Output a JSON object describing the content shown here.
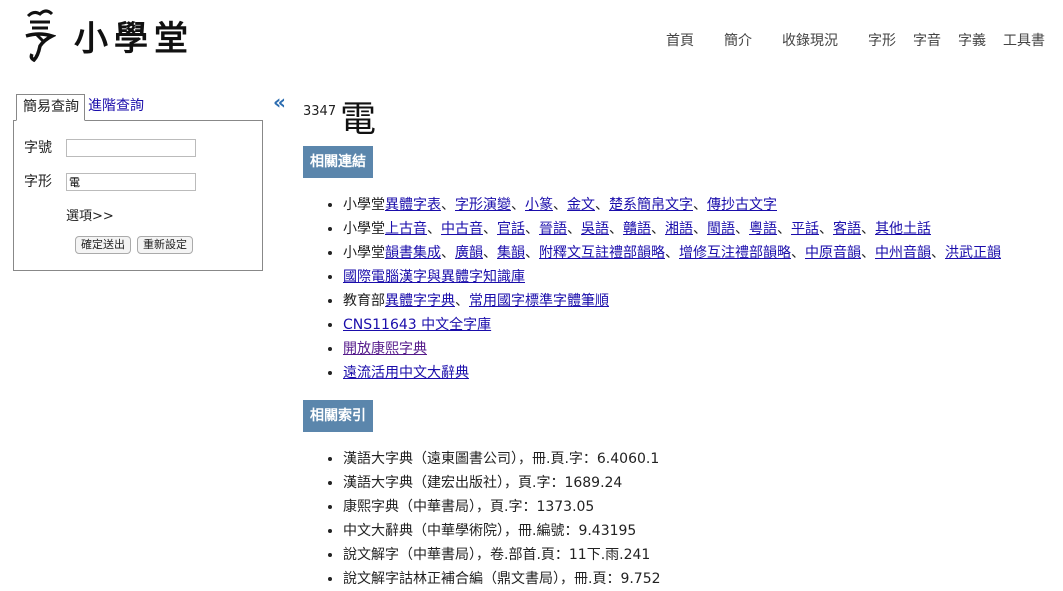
{
  "header": {
    "logo_text": "小學堂",
    "nav": [
      "首頁",
      "簡介",
      "收錄現況",
      "字形",
      "字音",
      "字義",
      "工具書"
    ]
  },
  "sidebar": {
    "tabs": [
      "簡易查詢",
      "進階查詢"
    ],
    "fields": [
      {
        "label": "字號",
        "value": ""
      },
      {
        "label": "字形",
        "value": "電"
      }
    ],
    "options_link": "選項>>",
    "submit_label": "確定送出",
    "reset_label": "重新設定",
    "collapse_icon": "«"
  },
  "entry": {
    "number": "3347",
    "character": "電"
  },
  "related_links": {
    "heading": "相關連結",
    "items": [
      {
        "prefix": "小學堂",
        "links": [
          "異體字表",
          "字形演變",
          "小篆",
          "金文",
          "楚系簡帛文字",
          "傳抄古文字"
        ]
      },
      {
        "prefix": "小學堂",
        "links": [
          "上古音",
          "中古音",
          "官話",
          "晉語",
          "吳語",
          "贛語",
          "湘語",
          "閩語",
          "粵語",
          "平話",
          "客語",
          "其他土話"
        ]
      },
      {
        "prefix": "小學堂",
        "links": [
          "韻書集成",
          "廣韻",
          "集韻",
          "附釋文互註禮部韻略",
          "增修互注禮部韻略",
          "中原音韻",
          "中州音韻",
          "洪武正韻"
        ]
      },
      {
        "prefix": "",
        "links": [
          "國際電腦漢字與異體字知識庫"
        ]
      },
      {
        "prefix": "教育部",
        "links": [
          "異體字字典",
          "常用國字標準字體筆順"
        ]
      },
      {
        "prefix": "",
        "links": [
          "CNS11643 中文全字庫"
        ]
      },
      {
        "prefix": "",
        "links": [
          "開放康熙字典"
        ]
      },
      {
        "prefix": "",
        "links": [
          "遠流活用中文大辭典"
        ]
      }
    ]
  },
  "related_index": {
    "heading": "相關索引",
    "items": [
      "漢語大字典（遠東圖書公司），冊.頁.字：6.4060.1",
      "漢語大字典（建宏出版社），頁.字：1689.24",
      "康熙字典（中華書局），頁.字：1373.05",
      "中文大辭典（中華學術院），冊.編號：9.43195",
      "說文解字（中華書局），卷.部首.頁：11下.雨.241",
      "說文解字詁林正補合編（鼎文書局），冊.頁：9.752"
    ]
  }
}
